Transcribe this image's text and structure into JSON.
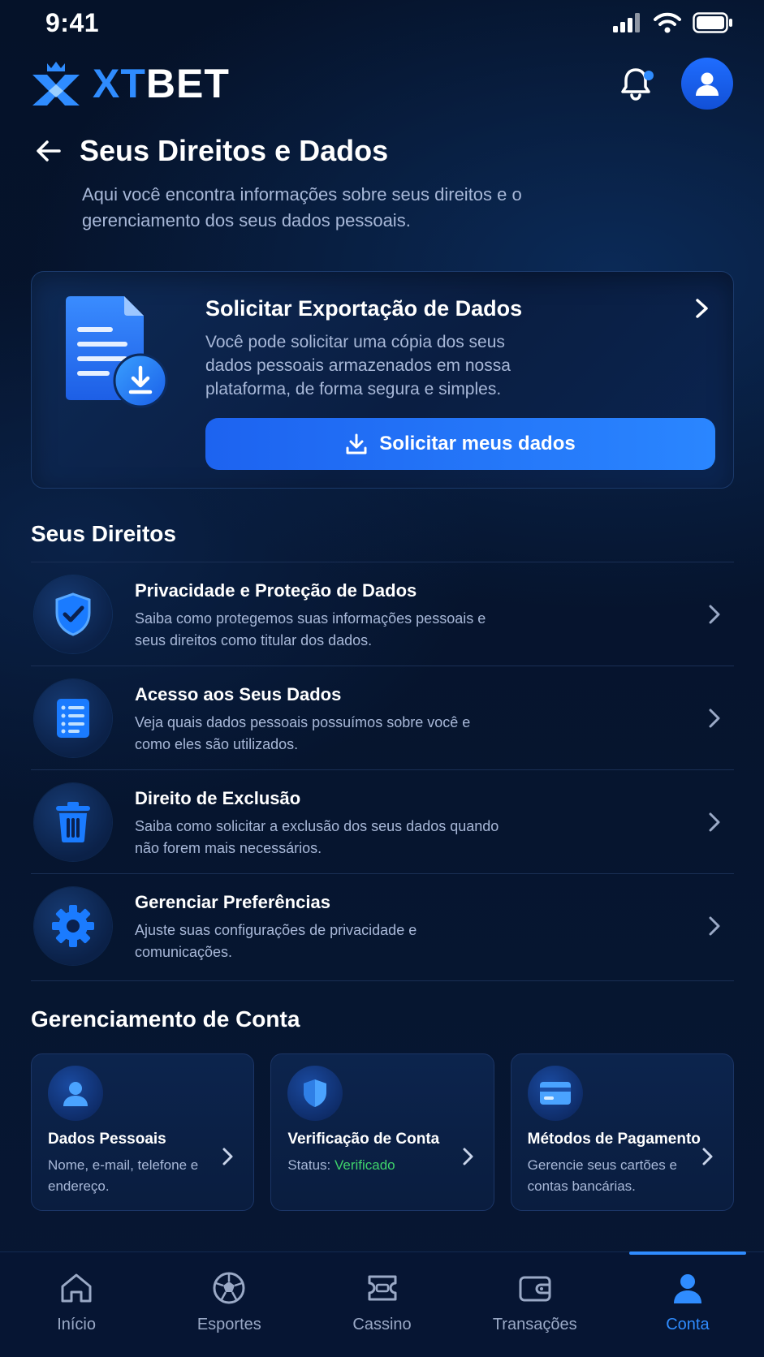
{
  "status_bar": {
    "time": "9:41"
  },
  "header": {
    "brand_xt": "XT",
    "brand_bet": "BET",
    "has_notification": true
  },
  "page": {
    "title": "Seus Direitos e Dados",
    "subtitle": "Aqui você encontra informações sobre seus direitos e o gerenciamento dos seus dados pessoais."
  },
  "export_card": {
    "title": "Solicitar Exportação de Dados",
    "description": "Você pode solicitar uma cópia dos seus dados pessoais armazenados em nossa plataforma, de forma segura e simples.",
    "button_label": "Solicitar meus dados",
    "icon": "document-download-icon"
  },
  "rights_section": {
    "title": "Seus Direitos",
    "items": [
      {
        "title": "Privacidade e Proteção de Dados",
        "description": "Saiba como protegemos suas informações pessoais e seus direitos como titular dos dados.",
        "icon": "shield-check-icon"
      },
      {
        "title": "Acesso aos Seus Dados",
        "description": "Veja quais dados pessoais possuímos sobre você e como eles são utilizados.",
        "icon": "list-document-icon"
      },
      {
        "title": "Direito de Exclusão",
        "description": "Saiba como solicitar a exclusão dos seus dados quando não forem mais necessários.",
        "icon": "trash-icon"
      },
      {
        "title": "Gerenciar Preferências",
        "description": "Ajuste suas configurações de privacidade e comunicações.",
        "icon": "gear-icon"
      }
    ]
  },
  "account_section": {
    "title": "Gerenciamento de Conta",
    "cards": [
      {
        "title": "Dados Pessoais",
        "description": "Nome, e-mail, telefone e endereço.",
        "icon": "user-icon"
      },
      {
        "title": "Verificação de Conta",
        "status_label": "Status: ",
        "status_value": "Verificado",
        "icon": "shield-icon"
      },
      {
        "title": "Métodos de Pagamento",
        "description": "Gerencie seus cartões e contas bancárias.",
        "icon": "card-icon"
      }
    ]
  },
  "bottom_nav": {
    "items": [
      {
        "label": "Início",
        "icon": "home-icon"
      },
      {
        "label": "Esportes",
        "icon": "ball-icon"
      },
      {
        "label": "Cassino",
        "icon": "ticket-icon"
      },
      {
        "label": "Transações",
        "icon": "wallet-icon"
      },
      {
        "label": "Conta",
        "icon": "user-icon",
        "active": true
      }
    ]
  },
  "colors": {
    "accent": "#2f8cff",
    "background": "#06122a",
    "verified": "#3fd36b",
    "muted_text": "#a8b8d8"
  }
}
